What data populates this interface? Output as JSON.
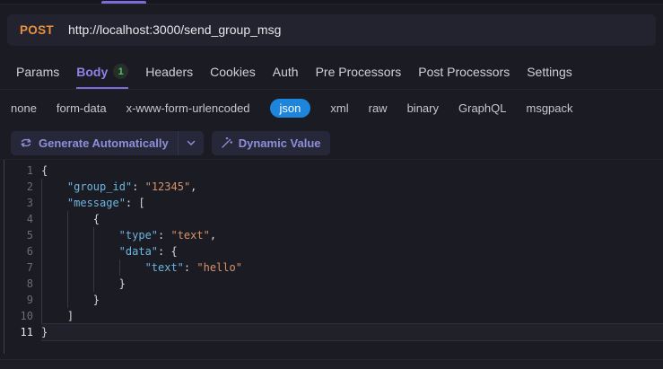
{
  "colors": {
    "accent_purple": "#7c6cdb",
    "method_orange": "#e8913c",
    "json_pill_blue": "#1e85dd",
    "badge_green": "#4fc167",
    "syntax_key_blue": "#6cb6e2",
    "syntax_string_orange": "#d6936a"
  },
  "request_bar": {
    "method": "POST",
    "url": "http://localhost:3000/send_group_msg"
  },
  "tabs": [
    {
      "label": "Params",
      "active": false
    },
    {
      "label": "Body",
      "badge": "1",
      "active": true
    },
    {
      "label": "Headers",
      "active": false
    },
    {
      "label": "Cookies",
      "active": false
    },
    {
      "label": "Auth",
      "active": false
    },
    {
      "label": "Pre Processors",
      "active": false
    },
    {
      "label": "Post Processors",
      "active": false
    },
    {
      "label": "Settings",
      "active": false
    }
  ],
  "body_types": [
    "none",
    "form-data",
    "x-www-form-urlencoded",
    "json",
    "xml",
    "raw",
    "binary",
    "GraphQL",
    "msgpack"
  ],
  "body_type_selected": "json",
  "toolbar": {
    "generate_label": "Generate Automatically",
    "dynamic_label": "Dynamic Value"
  },
  "editor": {
    "active_line": 11,
    "lines": [
      {
        "num": 1,
        "indent": 0,
        "tokens": [
          {
            "type": "punct",
            "text": "{"
          }
        ]
      },
      {
        "num": 2,
        "indent": 4,
        "tokens": [
          {
            "type": "key",
            "text": "\"group_id\""
          },
          {
            "type": "punct",
            "text": ": "
          },
          {
            "type": "str",
            "text": "\"12345\""
          },
          {
            "type": "punct",
            "text": ","
          }
        ]
      },
      {
        "num": 3,
        "indent": 4,
        "tokens": [
          {
            "type": "key",
            "text": "\"message\""
          },
          {
            "type": "punct",
            "text": ": ["
          }
        ]
      },
      {
        "num": 4,
        "indent": 8,
        "tokens": [
          {
            "type": "punct",
            "text": "{"
          }
        ]
      },
      {
        "num": 5,
        "indent": 12,
        "tokens": [
          {
            "type": "key",
            "text": "\"type\""
          },
          {
            "type": "punct",
            "text": ": "
          },
          {
            "type": "str",
            "text": "\"text\""
          },
          {
            "type": "punct",
            "text": ","
          }
        ]
      },
      {
        "num": 6,
        "indent": 12,
        "tokens": [
          {
            "type": "key",
            "text": "\"data\""
          },
          {
            "type": "punct",
            "text": ": {"
          }
        ]
      },
      {
        "num": 7,
        "indent": 16,
        "tokens": [
          {
            "type": "key",
            "text": "\"text\""
          },
          {
            "type": "punct",
            "text": ": "
          },
          {
            "type": "str",
            "text": "\"hello\""
          }
        ]
      },
      {
        "num": 8,
        "indent": 12,
        "tokens": [
          {
            "type": "punct",
            "text": "}"
          }
        ]
      },
      {
        "num": 9,
        "indent": 8,
        "tokens": [
          {
            "type": "punct",
            "text": "}"
          }
        ]
      },
      {
        "num": 10,
        "indent": 4,
        "tokens": [
          {
            "type": "punct",
            "text": "]"
          }
        ]
      },
      {
        "num": 11,
        "indent": 0,
        "tokens": [
          {
            "type": "punct",
            "text": "}"
          }
        ]
      }
    ]
  }
}
